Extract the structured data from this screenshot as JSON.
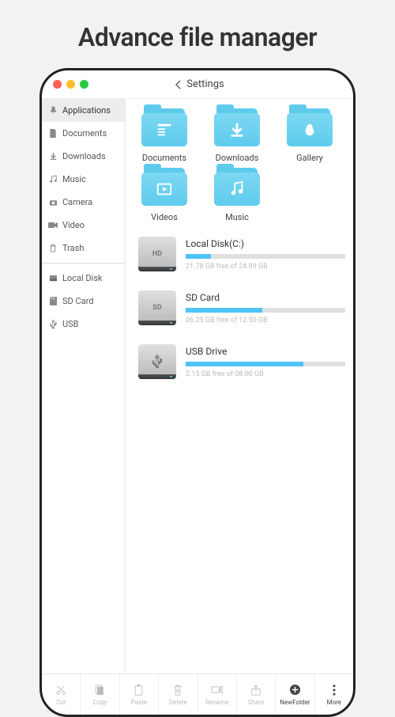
{
  "title": "Advance file manager",
  "header": {
    "back_label": "Settings"
  },
  "sidebar": {
    "section1": [
      {
        "label": "Applications",
        "icon": "pin"
      },
      {
        "label": "Documents",
        "icon": "doc"
      },
      {
        "label": "Downloads",
        "icon": "download"
      },
      {
        "label": "Music",
        "icon": "music"
      },
      {
        "label": "Camera",
        "icon": "camera"
      },
      {
        "label": "Video",
        "icon": "video"
      },
      {
        "label": "Trash",
        "icon": "trash"
      }
    ],
    "section2": [
      {
        "label": "Local Disk",
        "icon": "disk"
      },
      {
        "label": "SD Card",
        "icon": "sd"
      },
      {
        "label": "USB",
        "icon": "usb"
      }
    ]
  },
  "folders": [
    {
      "label": "Documents",
      "glyph": "doc"
    },
    {
      "label": "Downloads",
      "glyph": "download"
    },
    {
      "label": "Gallery",
      "glyph": "gallery"
    },
    {
      "label": "Videos",
      "glyph": "video"
    },
    {
      "label": "Music",
      "glyph": "music"
    }
  ],
  "storage": [
    {
      "name": "Local Disk(C:)",
      "badge": "HD",
      "used_pct": 16,
      "detail": "21.78 GB free of 24.89 GB"
    },
    {
      "name": "SD Card",
      "badge": "SD",
      "used_pct": 48,
      "detail": "06.25 GB free of 12.50 GB"
    },
    {
      "name": "USB Drive",
      "badge": "usb",
      "used_pct": 74,
      "detail": "2.15 GB free of 08.00 GB"
    }
  ],
  "toolbar": [
    {
      "label": "Cut",
      "icon": "cut"
    },
    {
      "label": "Copy",
      "icon": "copy"
    },
    {
      "label": "Paste",
      "icon": "paste"
    },
    {
      "label": "Delete",
      "icon": "delete"
    },
    {
      "label": "Rename",
      "icon": "rename"
    },
    {
      "label": "Share",
      "icon": "share"
    },
    {
      "label": "NewFolder",
      "icon": "add"
    },
    {
      "label": "More",
      "icon": "more"
    }
  ]
}
